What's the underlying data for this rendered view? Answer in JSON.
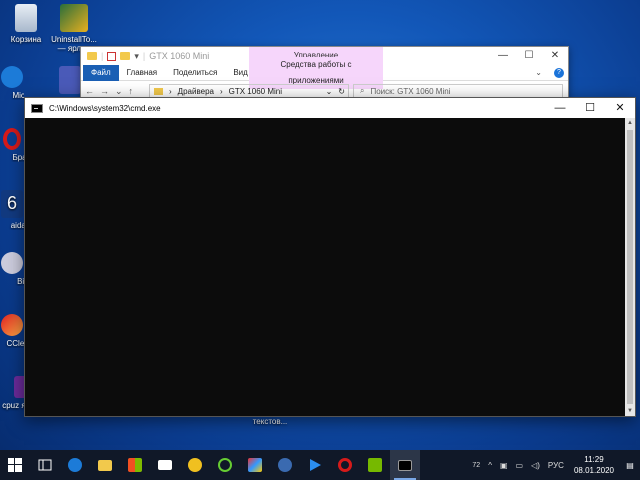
{
  "desktop": {
    "icons": [
      {
        "label": "Корзина"
      },
      {
        "label": "UninstallTo... — ярлык"
      },
      {
        "label": "Micr Ed"
      },
      {
        "label": "Бра Op"
      },
      {
        "label": "aida ярл"
      },
      {
        "label": "BitTo"
      },
      {
        "label": "CClea — я"
      },
      {
        "label": "cpuz ярлык"
      },
      {
        "label": "текстов..."
      }
    ]
  },
  "explorer": {
    "title": "GTX 1060 Mini",
    "manage_header": "Управление",
    "tabs": [
      "Файл",
      "Главная",
      "Поделиться",
      "Вид"
    ],
    "manage_tab": "Средства работы с приложениями",
    "breadcrumb": [
      "Драйвера",
      "GTX 1060 Mini"
    ],
    "search_placeholder": "Поиск: GTX 1060 Mini"
  },
  "cmd": {
    "title": "C:\\Windows\\system32\\cmd.exe"
  },
  "taskbar": {
    "tray": {
      "chevron": "^",
      "lang": "РУС",
      "time": "11:29",
      "date": "08.01.2020",
      "badge": "72"
    }
  },
  "colors": {
    "taskbar": "#101828",
    "accent": "#1a5fb4",
    "console": "#0c0c0c"
  }
}
